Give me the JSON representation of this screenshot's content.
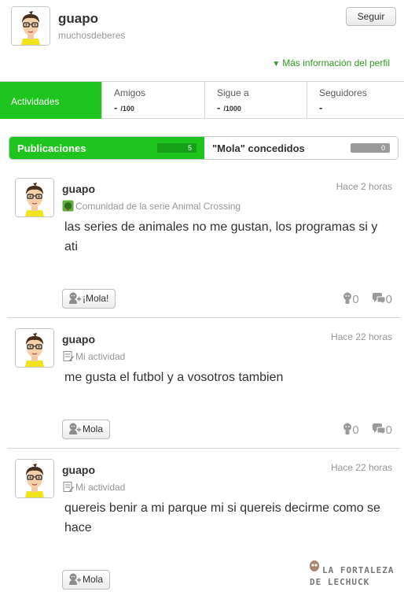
{
  "profile": {
    "name": "guapo",
    "username": "muchosdeberes",
    "follow_label": "Seguir",
    "more_info_label": "Más información del perfil"
  },
  "stats": {
    "activity_label": "Actividades",
    "friends": {
      "title": "Amigos",
      "value": "-",
      "max": "/100"
    },
    "following": {
      "title": "Sigue a",
      "value": "-",
      "max": "/1000"
    },
    "followers": {
      "title": "Seguidores",
      "value": "-"
    }
  },
  "tabs": {
    "posts": {
      "label": "Publicaciones",
      "count": "5"
    },
    "yeahs": {
      "label": "\"Mola\" concedidos",
      "count": "0"
    }
  },
  "posts": [
    {
      "name": "guapo",
      "time": "Hace 2 horas",
      "community": "Comunidad de la serie Animal Crossing",
      "community_icon": "animal-crossing-leaf-icon",
      "text": "las series de animales no me gustan, los programas si y ati",
      "mola_label": "¡Mola!",
      "yeahs": "0",
      "comments": "0"
    },
    {
      "name": "guapo",
      "time": "Hace 22 horas",
      "community": "Mi actividad",
      "community_icon": "diary-icon",
      "text": "me gusta el futbol y a vosotros tambien",
      "mola_label": "Mola",
      "yeahs": "0",
      "comments": "0"
    },
    {
      "name": "guapo",
      "time": "Hace 22 horas",
      "community": "Mi actividad",
      "community_icon": "diary-icon",
      "text": "quereis benir a mi parque mi si quereis decirme como se hace",
      "mola_label": "Mola"
    }
  ],
  "watermark": {
    "line1": "LA FORTALEZA",
    "line2": "DE LECHUCK"
  },
  "colors": {
    "accent_green": "#1ec51e",
    "link_green": "#2aa11a",
    "text": "#323232",
    "muted": "#969696"
  }
}
